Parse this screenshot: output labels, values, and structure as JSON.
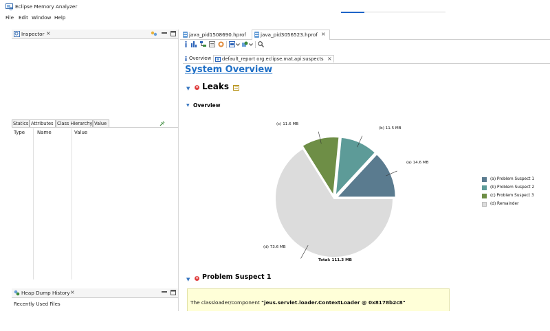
{
  "app": {
    "title": "Eclipse Memory Analyzer"
  },
  "menu": [
    "File",
    "Edit",
    "Window",
    "Help"
  ],
  "inspector": {
    "title": "Inspector",
    "close": "×"
  },
  "attributes": {
    "tabs": [
      "Statics",
      "Attributes",
      "Class Hierarchy",
      "Value"
    ],
    "selected_tab": "Attributes",
    "columns": [
      "Type",
      "Name",
      "Value"
    ]
  },
  "heap_history": {
    "title": "Heap Dump History",
    "close": "×",
    "recent": "Recently Used Files"
  },
  "editor_tabs": [
    {
      "label": "java_pid1508690.hprof",
      "selected": false
    },
    {
      "label": "java_pid3056523.hprof",
      "selected": true,
      "close": "×"
    }
  ],
  "sub_tabs": [
    {
      "label": "Overview",
      "selected": false
    },
    {
      "label": "default_report org.eclipse.mat.api:suspects",
      "selected": true,
      "close": "×"
    }
  ],
  "report": {
    "title": "System Overview",
    "leaks_heading": "Leaks",
    "overview_heading": "Overview",
    "problem_heading": "Problem Suspect 1",
    "problem_text_prefix": "The classloader/component ",
    "problem_text_bold": "\"jeus.servlet.loader.ContextLoader @ 0x8178b2c8\""
  },
  "colors": {
    "slice_a": "#5a7b8f",
    "slice_b": "#5d9b98",
    "slice_c": "#6e8e46",
    "slice_d": "#dcdcdc",
    "link_blue": "#1f6fc6",
    "accent_blue": "#1e64c8"
  },
  "chart_data": {
    "type": "pie",
    "total_label": "Total: 111.3 MB",
    "slices": [
      {
        "label": "(a) 14.6 MB",
        "legend": "(a)  Problem Suspect 1",
        "value": 14.6
      },
      {
        "label": "(b) 11.5 MB",
        "legend": "(b)  Problem Suspect 2",
        "value": 11.5
      },
      {
        "label": "(c) 11.6 MB",
        "legend": "(c)  Problem Suspect 3",
        "value": 11.6
      },
      {
        "label": "(d) 73.6 MB",
        "legend": "(d)  Remainder",
        "value": 73.6
      }
    ],
    "legend_position": "right"
  }
}
